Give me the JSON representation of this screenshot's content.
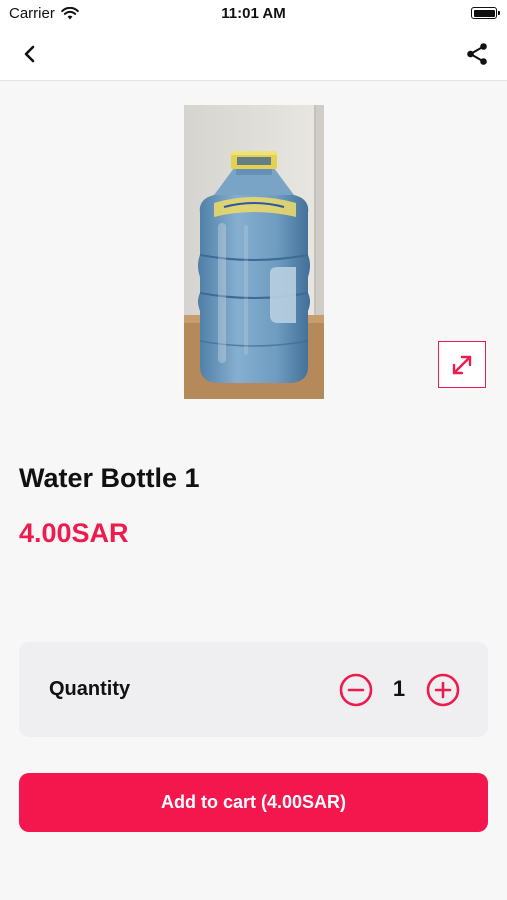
{
  "status_bar": {
    "carrier": "Carrier",
    "time": "11:01 AM",
    "icons": [
      "wifi-icon",
      "battery-icon"
    ]
  },
  "nav": {
    "back_icon": "chevron-left-icon",
    "share_icon": "share-icon"
  },
  "product": {
    "title": "Water Bottle 1",
    "price": "4.00SAR",
    "image_subject": "water-jug-photo",
    "expand_icon": "expand-arrows-icon"
  },
  "quantity": {
    "label": "Quantity",
    "value": "1",
    "decrement_icon": "minus-circle-icon",
    "increment_icon": "plus-circle-icon"
  },
  "cart": {
    "button_label": "Add to cart (4.00SAR)"
  },
  "colors": {
    "accent": "#F4174D",
    "price": "#EE1B4F",
    "background": "#F7F7F7",
    "card": "#EFEFF1"
  }
}
